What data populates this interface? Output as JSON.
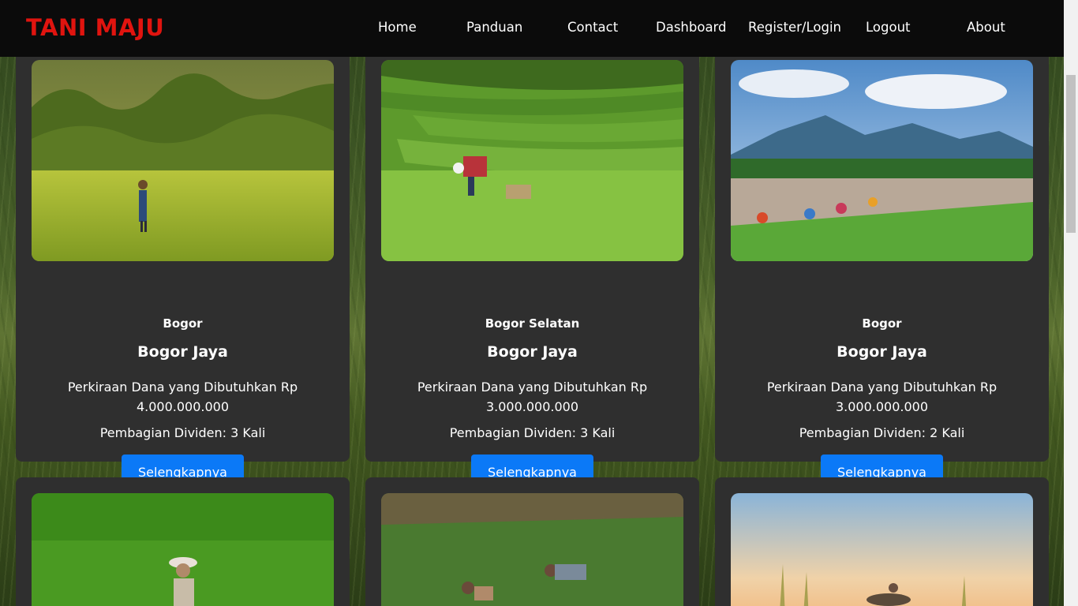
{
  "brand": "TANI MAJU",
  "nav": {
    "home": "Home",
    "panduan": "Panduan",
    "contact": "Contact",
    "dashboard": "Dashboard",
    "register_login": "Register/Login",
    "logout": "Logout",
    "about": "About"
  },
  "cards": [
    {
      "location": "Bogor",
      "name": "Bogor Jaya",
      "fund": "Perkiraan Dana yang Dibutuhkan Rp 4.000.000.000",
      "dividend": "Pembagian Dividen: 3 Kali",
      "button": "Selengkapnya"
    },
    {
      "location": "Bogor Selatan",
      "name": "Bogor Jaya",
      "fund": "Perkiraan Dana yang Dibutuhkan Rp 3.000.000.000",
      "dividend": "Pembagian Dividen: 3 Kali",
      "button": "Selengkapnya"
    },
    {
      "location": "Bogor",
      "name": "Bogor Jaya",
      "fund": "Perkiraan Dana yang Dibutuhkan Rp 3.000.000.000",
      "dividend": "Pembagian Dividen: 2 Kali",
      "button": "Selengkapnya"
    }
  ],
  "colors": {
    "brand": "#e0140f",
    "navbar": "#0b0b0b",
    "card": "#2f2f2f",
    "button": "#0b79f7"
  }
}
